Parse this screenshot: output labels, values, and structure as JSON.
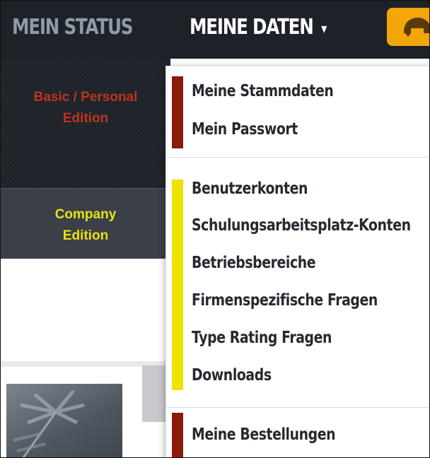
{
  "nav": {
    "status_label": "MEIN STATUS",
    "daten_label": "MEINE DATEN",
    "caret": "▾",
    "helmet_icon": "pilot-helmet-icon"
  },
  "sidebar": {
    "basic_edition": "Basic / Personal Edition",
    "company_edition": "Company Edition"
  },
  "dropdown": {
    "group1": [
      "Meine Stammdaten",
      "Mein Passwort"
    ],
    "group2": [
      "Benutzerkonten",
      "Schulungsarbeitsplatz-Konten",
      "Betriebsbereiche",
      "Firmenspezifische Fragen",
      "Type Rating Fragen",
      "Downloads"
    ],
    "group3": [
      "Meine Bestellungen"
    ]
  },
  "colors": {
    "nav_bg": "#1d2128",
    "accent_orange": "#f2a60a",
    "basic_red": "#c0341d",
    "company_yellow": "#ece110",
    "bar_red": "#8b1a0a",
    "bar_yellow": "#f0e200"
  }
}
